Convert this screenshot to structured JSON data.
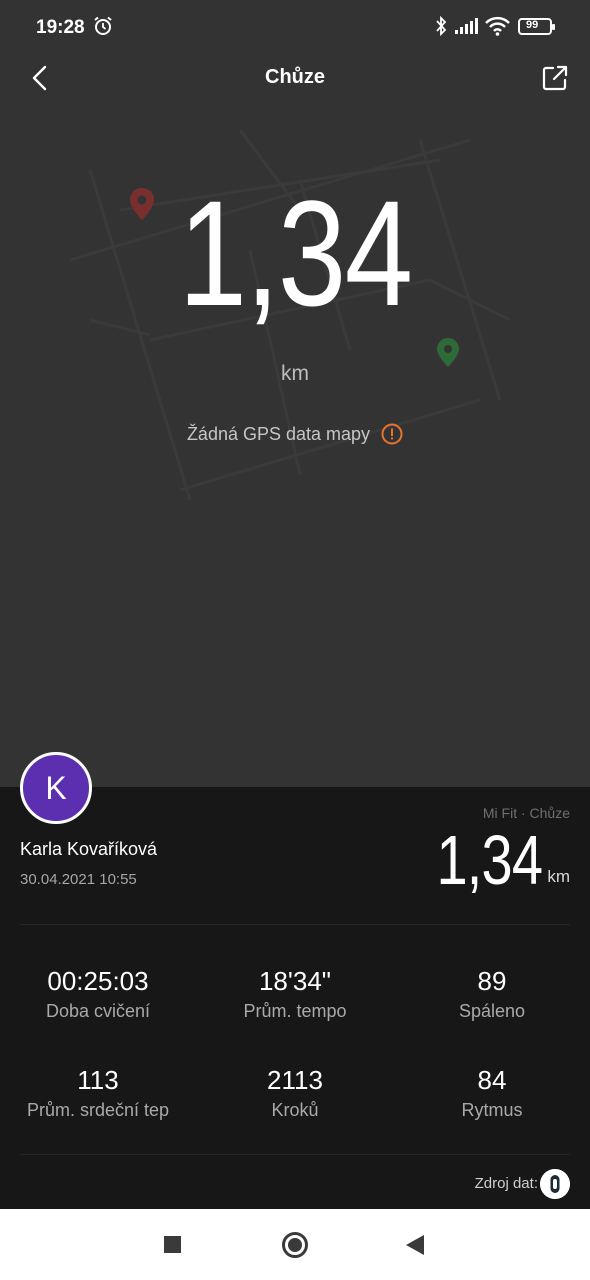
{
  "status_bar": {
    "time": "19:28",
    "battery": "99",
    "icons": [
      "alarm-icon",
      "bluetooth-icon",
      "signal-icon",
      "wifi-icon",
      "battery-icon"
    ]
  },
  "header": {
    "title": "Chůze",
    "back_icon": "chevron-left-icon",
    "share_icon": "share-icon"
  },
  "hero": {
    "distance": "1,34",
    "unit": "km",
    "gps_message": "Žádná GPS data mapy",
    "gps_icon": "warning-circle-icon"
  },
  "summary": {
    "avatar_letter": "K",
    "user_name": "Karla Kovaříková",
    "date": "30.04.2021 10:55",
    "source": "Mi Fit · Chůze",
    "distance": "1,34",
    "unit": "km"
  },
  "stats": [
    {
      "value": "00:25:03",
      "label": "Doba cvičení"
    },
    {
      "value": "18'34\"",
      "label": "Prům. tempo"
    },
    {
      "value": "89",
      "label": "Spáleno"
    },
    {
      "value": "113",
      "label": "Prům. srdeční tep"
    },
    {
      "value": "2113",
      "label": "Kroků"
    },
    {
      "value": "84",
      "label": "Rytmus"
    }
  ],
  "footer": {
    "data_source_label": "Zdroj dat:",
    "device_icon": "band-device-icon"
  },
  "colors": {
    "background": "#333333",
    "panel": "#171717",
    "avatar": "#5b2fb0",
    "warning": "#e8742c",
    "start_pin": "#7a2f2f",
    "end_pin": "#2f6a36"
  }
}
